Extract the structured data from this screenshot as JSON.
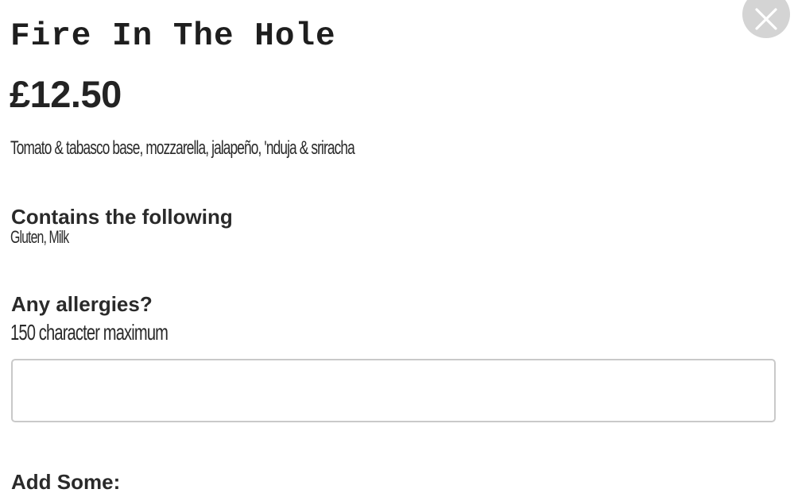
{
  "modal": {
    "title": "Fire In The Hole",
    "price": "£12.50",
    "description": "Tomato & tabasco base, mozzarella, jalapeño, 'nduja & sriracha",
    "contains": {
      "heading": "Contains the following",
      "allergens": "Gluten, Milk"
    },
    "allergies": {
      "heading": "Any allergies?",
      "hint": "150 character maximum",
      "value": "",
      "placeholder": ""
    },
    "add_some": {
      "heading": "Add Some:"
    },
    "close_icon": "close-icon"
  }
}
